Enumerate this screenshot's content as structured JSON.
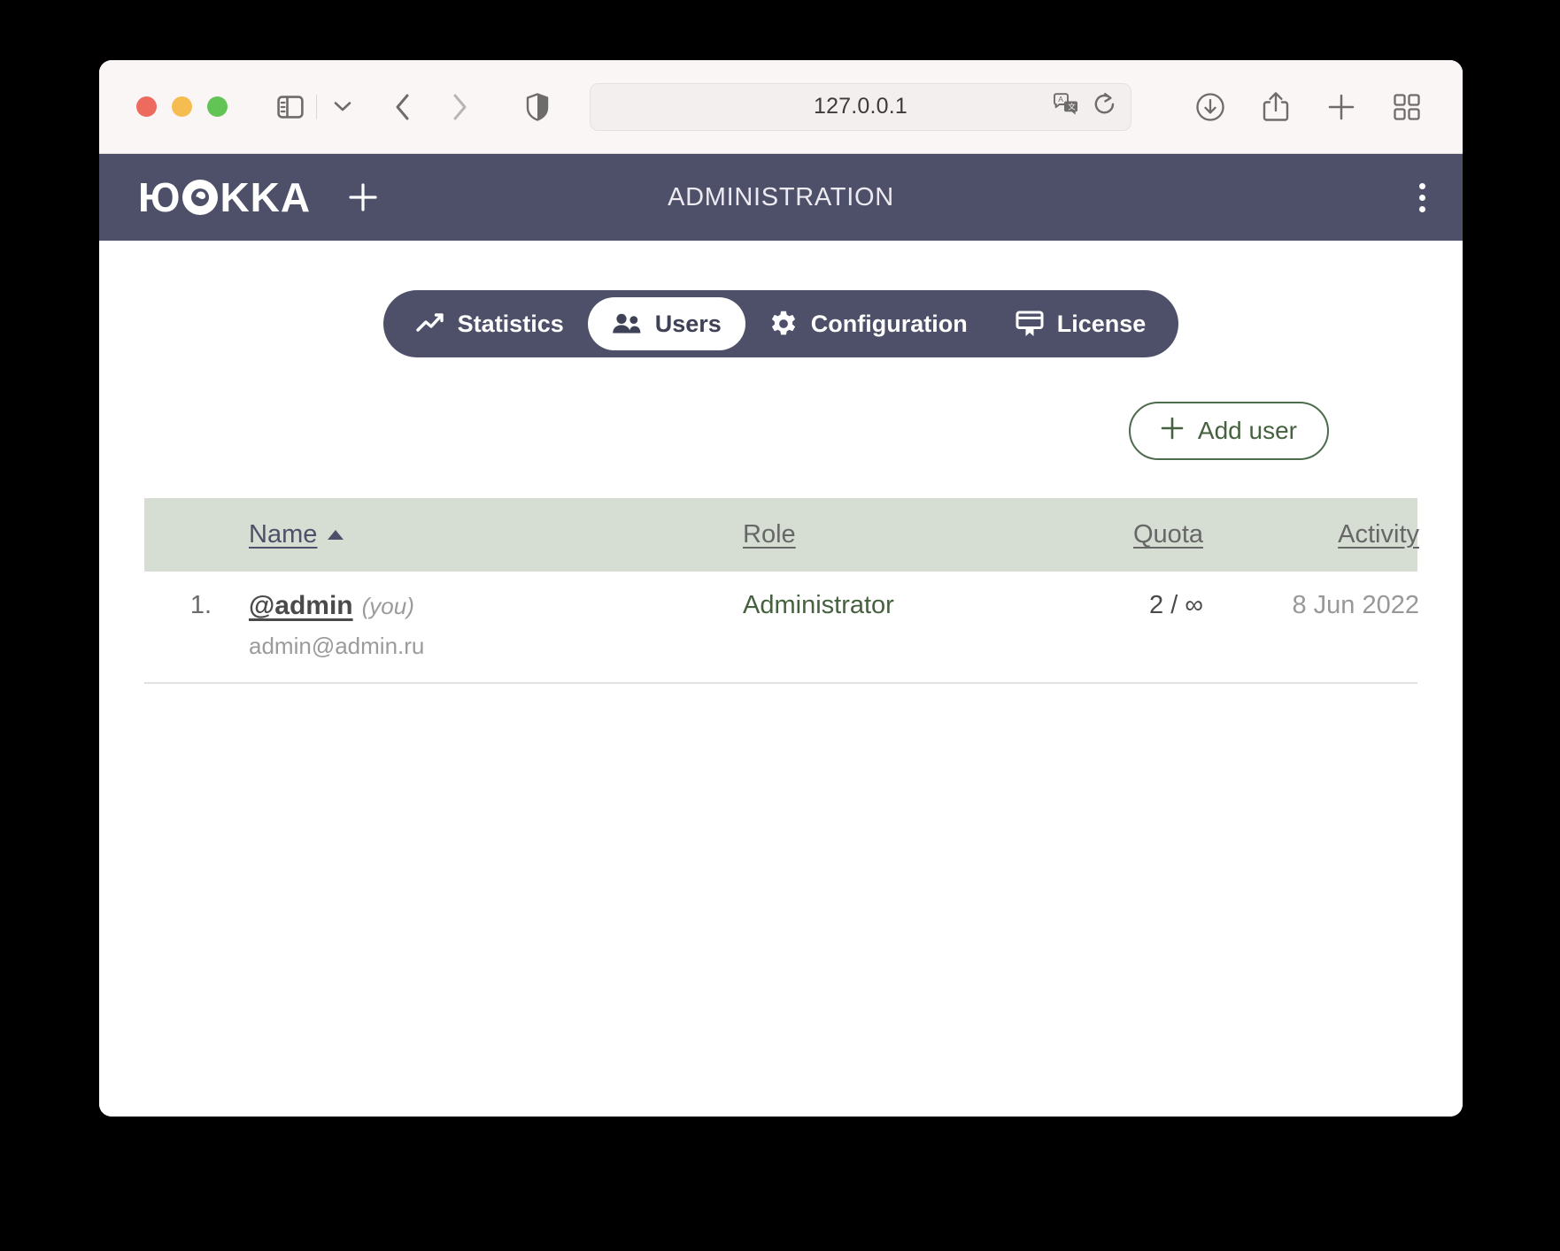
{
  "browser": {
    "url": "127.0.0.1",
    "traffic_lights": [
      "close",
      "minimize",
      "zoom"
    ],
    "icons": {
      "sidebar": "sidebar-toggle-icon",
      "sidebar_chevron": "chevron-down-icon",
      "back": "back-chevron-icon",
      "forward": "forward-chevron-icon",
      "shield": "privacy-shield-icon",
      "translate": "translate-icon",
      "reload": "reload-icon",
      "downloads": "download-icon",
      "share": "share-icon",
      "new_tab": "plus-icon",
      "tab_overview": "tab-overview-icon"
    }
  },
  "app": {
    "logo": "ЮККА",
    "logo_prefix": "Ю",
    "logo_suffix": "KKA",
    "title": "ADMINISTRATION",
    "add_tab_label": "+",
    "menu_label": "kebab-menu",
    "colors": {
      "header_bg": "#4d5068",
      "accent_green": "#46613f",
      "table_header_bg": "#d6ded4"
    }
  },
  "tabs": [
    {
      "label": "Statistics",
      "icon": "trend-line-icon",
      "active": false
    },
    {
      "label": "Users",
      "icon": "users-icon",
      "active": true
    },
    {
      "label": "Configuration",
      "icon": "gear-icon",
      "active": false
    },
    {
      "label": "License",
      "icon": "certificate-icon",
      "active": false
    }
  ],
  "toolbar": {
    "add_user_label": "Add user",
    "add_user_icon": "plus-icon"
  },
  "table": {
    "columns": [
      {
        "key": "index",
        "label": ""
      },
      {
        "key": "name",
        "label": "Name",
        "sorted": "asc"
      },
      {
        "key": "role",
        "label": "Role"
      },
      {
        "key": "quota",
        "label": "Quota"
      },
      {
        "key": "activity",
        "label": "Activity"
      }
    ],
    "rows": [
      {
        "index": "1.",
        "username": "@admin",
        "badge": "(you)",
        "email": "admin@admin.ru",
        "role": "Administrator",
        "quota": "2 / ∞",
        "activity": "8 Jun 2022"
      }
    ]
  }
}
